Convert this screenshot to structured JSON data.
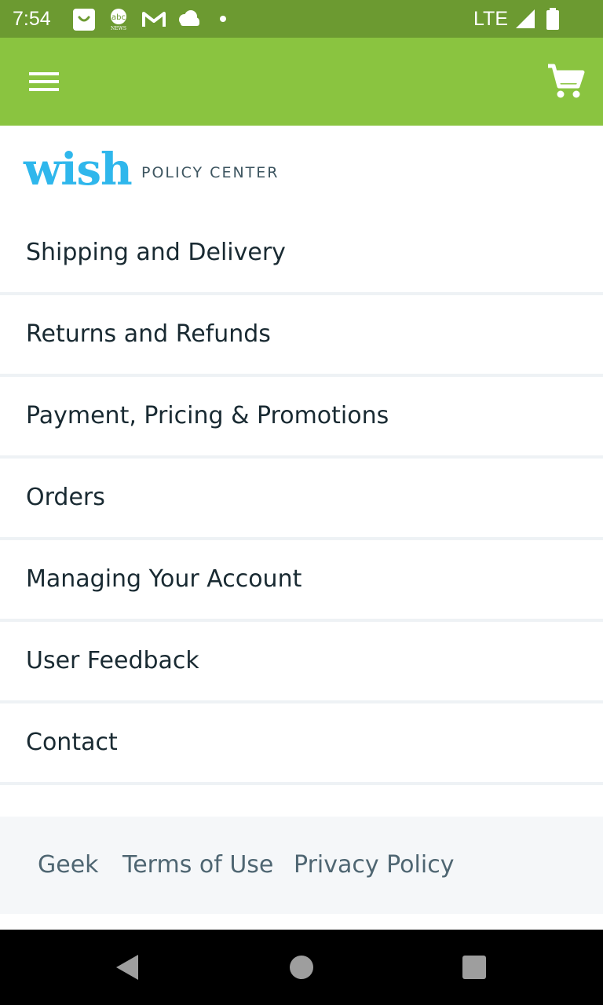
{
  "status_bar": {
    "time": "7:54",
    "network": "LTE",
    "icons": [
      "shopping-bag-icon",
      "abc-news-icon",
      "gmail-icon",
      "cloud-icon",
      "dot-icon",
      "signal-icon",
      "battery-icon"
    ],
    "background_color": "#6c9a31"
  },
  "app_bar": {
    "background_color": "#8ac440",
    "menu_icon": "hamburger-menu-icon",
    "cart_icon": "shopping-cart-icon"
  },
  "header": {
    "logo_text": "wish",
    "subtitle": "POLICY CENTER",
    "logo_color": "#2fb7ec"
  },
  "menu": {
    "items": [
      {
        "label": "Shipping and Delivery"
      },
      {
        "label": "Returns and Refunds"
      },
      {
        "label": "Payment, Pricing & Promotions"
      },
      {
        "label": "Orders"
      },
      {
        "label": "Managing Your Account"
      },
      {
        "label": "User Feedback"
      },
      {
        "label": "Contact"
      }
    ]
  },
  "footer": {
    "links": [
      {
        "label": "Geek"
      },
      {
        "label": "Terms of Use"
      },
      {
        "label": "Privacy Policy"
      }
    ]
  },
  "nav_bar": {
    "icons": [
      "back-icon",
      "home-icon",
      "recents-icon"
    ]
  }
}
